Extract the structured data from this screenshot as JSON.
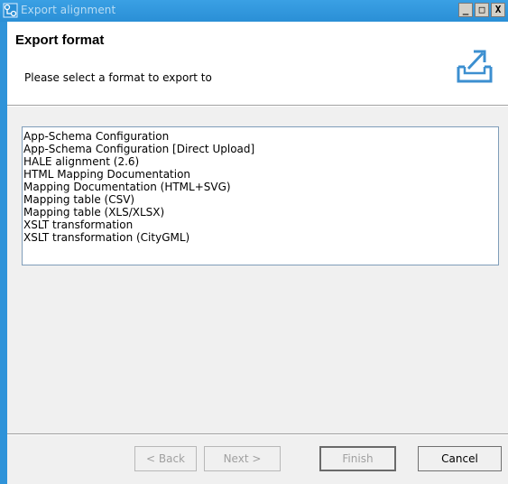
{
  "window": {
    "title": "Export alignment",
    "controls": {
      "minimize": "_",
      "maximize": "□",
      "close": "X"
    }
  },
  "header": {
    "title": "Export format",
    "description": "Please select a format to export to",
    "art_icon": "export-tray-icon"
  },
  "formats": [
    "App-Schema Configuration",
    "App-Schema Configuration [Direct Upload]",
    "HALE alignment (2.6)",
    "HTML Mapping Documentation",
    "Mapping Documentation (HTML+SVG)",
    "Mapping table (CSV)",
    "Mapping table (XLS/XLSX)",
    "XSLT transformation",
    "XSLT transformation (CityGML)"
  ],
  "buttons": {
    "back": "< Back",
    "next": "Next >",
    "finish": "Finish",
    "cancel": "Cancel"
  },
  "colors": {
    "titlebar": "#2a8fd6",
    "dialog_bg": "#f0f0f0",
    "header_bg": "#ffffff",
    "icon_accent": "#3c8fd0"
  }
}
